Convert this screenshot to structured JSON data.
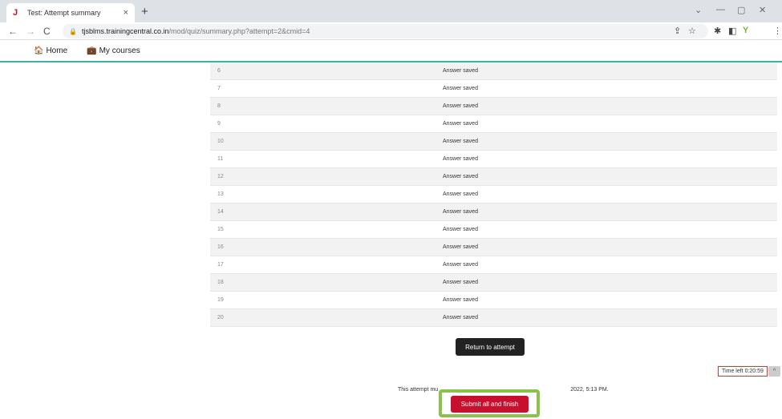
{
  "browser": {
    "tab_title": "Test: Attempt summary",
    "tab_close": "×",
    "new_tab": "+",
    "url_host": "tjsblms.trainingcentral.co.in",
    "url_path": "/mod/quiz/summary.php?attempt=2&cmid=4"
  },
  "nav": {
    "home": "Home",
    "my_courses": "My courses"
  },
  "summary": {
    "rows": [
      {
        "q": "6",
        "status": "Answer saved"
      },
      {
        "q": "7",
        "status": "Answer saved"
      },
      {
        "q": "8",
        "status": "Answer saved"
      },
      {
        "q": "9",
        "status": "Answer saved"
      },
      {
        "q": "10",
        "status": "Answer saved"
      },
      {
        "q": "11",
        "status": "Answer saved"
      },
      {
        "q": "12",
        "status": "Answer saved"
      },
      {
        "q": "13",
        "status": "Answer saved"
      },
      {
        "q": "14",
        "status": "Answer saved"
      },
      {
        "q": "15",
        "status": "Answer saved"
      },
      {
        "q": "16",
        "status": "Answer saved"
      },
      {
        "q": "17",
        "status": "Answer saved"
      },
      {
        "q": "18",
        "status": "Answer saved"
      },
      {
        "q": "19",
        "status": "Answer saved"
      },
      {
        "q": "20",
        "status": "Answer saved"
      }
    ]
  },
  "actions": {
    "return_label": "Return to attempt",
    "submit_label": "Submit all and finish"
  },
  "timer": {
    "label": "Time left 0:20:59",
    "toggle": "^"
  },
  "deadline": {
    "left": "This attempt mu",
    "right": "2022, 5:13 PM."
  },
  "colors": {
    "submit": "#c8102e",
    "highlight": "#8bc34a",
    "nav_border": "#3bb3a6"
  }
}
